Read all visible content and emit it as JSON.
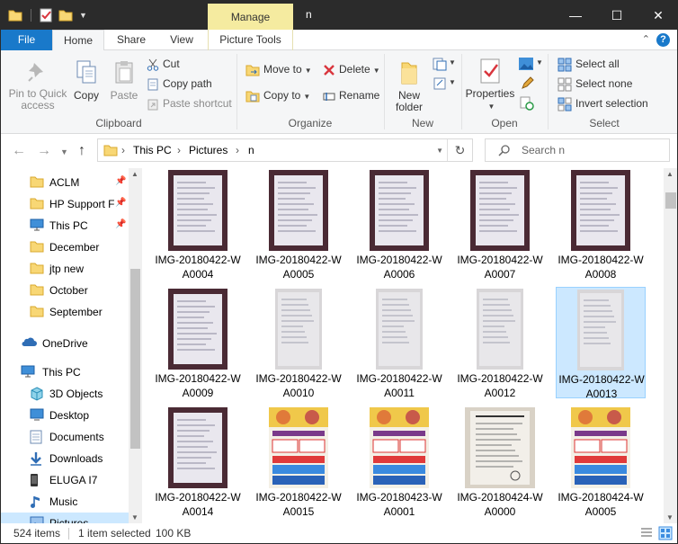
{
  "window": {
    "title": "n",
    "manage_tab": "Manage",
    "minimize": "—",
    "maximize": "☐",
    "close": "✕"
  },
  "tabs": {
    "file": "File",
    "home": "Home",
    "share": "Share",
    "view": "View",
    "picture_tools": "Picture Tools"
  },
  "ribbon": {
    "clipboard": {
      "label": "Clipboard",
      "pin_line1": "Pin to Quick",
      "pin_line2": "access",
      "copy": "Copy",
      "paste": "Paste",
      "cut": "Cut",
      "copy_path": "Copy path",
      "paste_shortcut": "Paste shortcut"
    },
    "organize": {
      "label": "Organize",
      "move_to": "Move to",
      "copy_to": "Copy to",
      "delete": "Delete",
      "rename": "Rename"
    },
    "new": {
      "label": "New",
      "new_folder_line1": "New",
      "new_folder_line2": "folder"
    },
    "open": {
      "label": "Open",
      "properties": "Properties"
    },
    "select": {
      "label": "Select",
      "select_all": "Select all",
      "select_none": "Select none",
      "invert_selection": "Invert selection"
    }
  },
  "address": {
    "crumbs": [
      "This PC",
      "Pictures",
      "n"
    ],
    "separator": "›"
  },
  "search": {
    "placeholder": "Search n"
  },
  "nav_pane": {
    "quick_access": [
      {
        "label": "ACLM",
        "pinned": true
      },
      {
        "label": "HP Support F",
        "pinned": true
      },
      {
        "label": "This PC",
        "pinned": true
      },
      {
        "label": "December",
        "pinned": false
      },
      {
        "label": "jtp new",
        "pinned": false
      },
      {
        "label": "October",
        "pinned": false
      },
      {
        "label": "September",
        "pinned": false
      }
    ],
    "onedrive": "OneDrive",
    "this_pc": "This PC",
    "this_pc_items": [
      "3D Objects",
      "Desktop",
      "Documents",
      "Downloads",
      "ELUGA I7",
      "Music",
      "Pictures"
    ]
  },
  "files": [
    {
      "line1": "IMG-20180422-W",
      "line2": "A0004",
      "kind": "doc-dark"
    },
    {
      "line1": "IMG-20180422-W",
      "line2": "A0005",
      "kind": "doc-dark"
    },
    {
      "line1": "IMG-20180422-W",
      "line2": "A0006",
      "kind": "doc-dark"
    },
    {
      "line1": "IMG-20180422-W",
      "line2": "A0007",
      "kind": "doc-dark"
    },
    {
      "line1": "IMG-20180422-W",
      "line2": "A0008",
      "kind": "doc-dark"
    },
    {
      "line1": "IMG-20180422-W",
      "line2": "A0009",
      "kind": "doc-dark"
    },
    {
      "line1": "IMG-20180422-W",
      "line2": "A0010",
      "kind": "doc-light"
    },
    {
      "line1": "IMG-20180422-W",
      "line2": "A0011",
      "kind": "doc-light"
    },
    {
      "line1": "IMG-20180422-W",
      "line2": "A0012",
      "kind": "doc-light"
    },
    {
      "line1": "IMG-20180422-W",
      "line2": "A0013",
      "kind": "doc-light",
      "selected": true
    },
    {
      "line1": "IMG-20180422-W",
      "line2": "A0014",
      "kind": "doc-dark"
    },
    {
      "line1": "IMG-20180422-W",
      "line2": "A0015",
      "kind": "poster"
    },
    {
      "line1": "IMG-20180423-W",
      "line2": "A0001",
      "kind": "poster"
    },
    {
      "line1": "IMG-20180424-W",
      "line2": "A0000",
      "kind": "notice"
    },
    {
      "line1": "IMG-20180424-W",
      "line2": "A0005",
      "kind": "poster"
    }
  ],
  "status": {
    "count": "524 items",
    "selection": "1 item selected",
    "size": "100 KB"
  },
  "colors": {
    "accent": "#1979ca",
    "selection": "#cce8ff",
    "manage_tab": "#f5eba0",
    "titlebar": "#2b2b2b"
  }
}
